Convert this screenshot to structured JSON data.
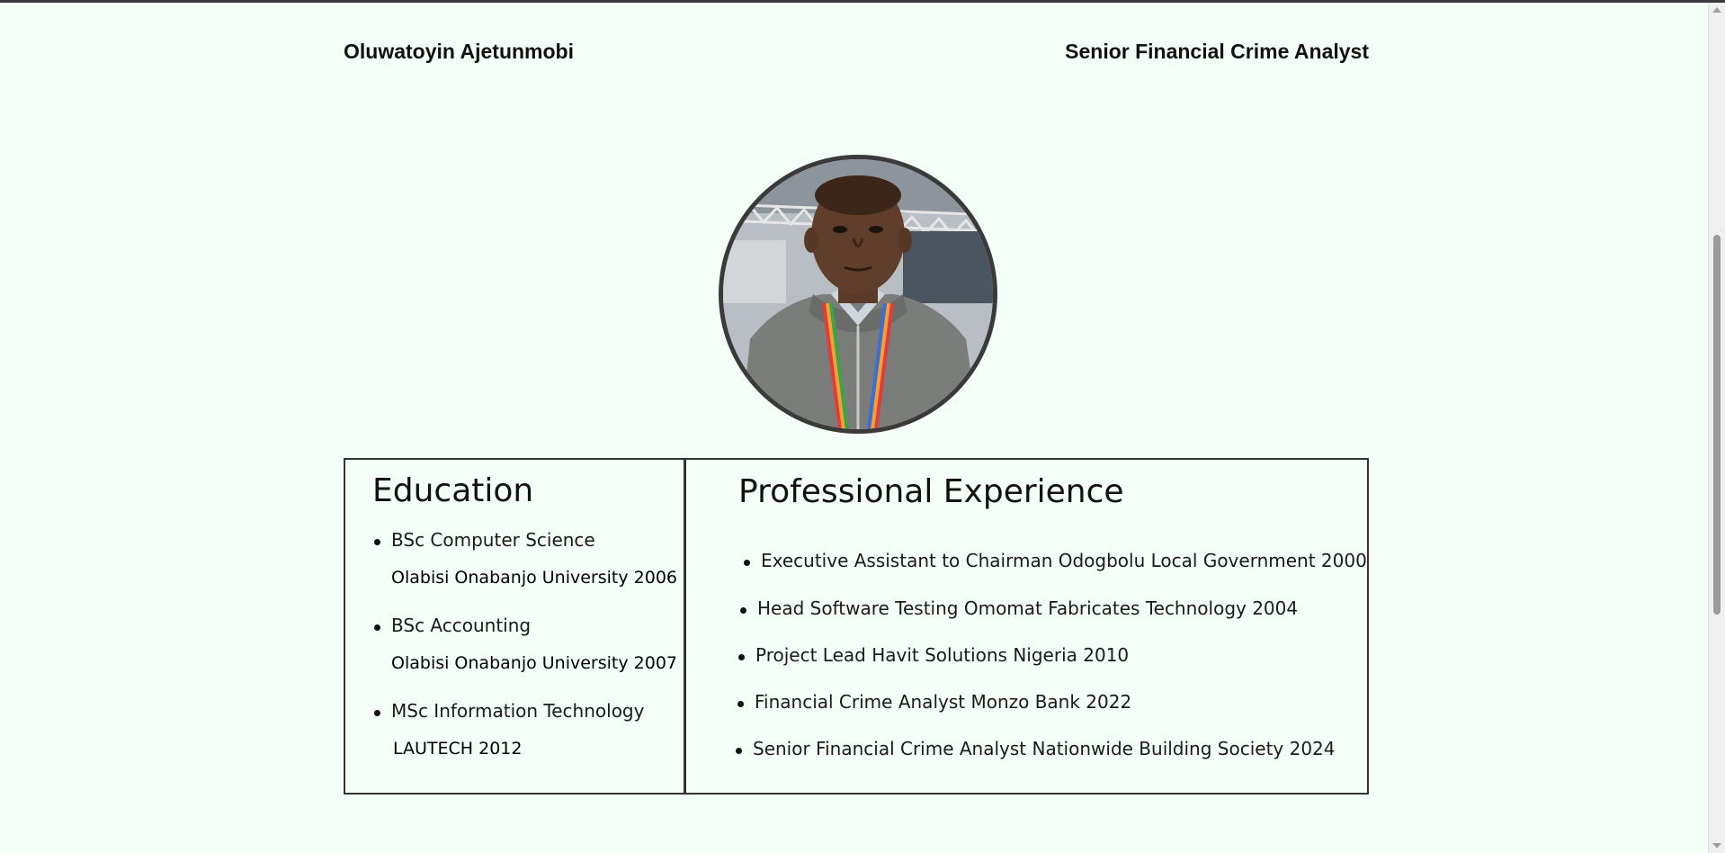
{
  "header": {
    "name": "Oluwatoyin Ajetunmobi",
    "title": "Senior Financial Crime Analyst"
  },
  "profile_photo": {
    "icon": "profile-photo"
  },
  "education": {
    "heading": "Education",
    "items": [
      {
        "degree": "BSc Computer Science",
        "institution": "Olabisi Onabanjo University 2006"
      },
      {
        "degree": "BSc Accounting",
        "institution": "Olabisi Onabanjo University 2007"
      },
      {
        "degree": "MSc Information Technology",
        "institution": "LAUTECH 2012"
      }
    ]
  },
  "experience": {
    "heading": "Professional Experience",
    "items": [
      "Executive Assistant to Chairman Odogbolu Local Government 2000",
      "Head Software Testing Omomat Fabricates Technology 2004",
      "Project Lead Havit Solutions Nigeria 2010",
      "Financial Crime Analyst Monzo Bank 2022",
      "Senior Financial Crime Analyst Nationwide Building Society 2024"
    ]
  },
  "colors": {
    "background": "#f4fff7",
    "border": "#333333",
    "text": "#111111"
  }
}
